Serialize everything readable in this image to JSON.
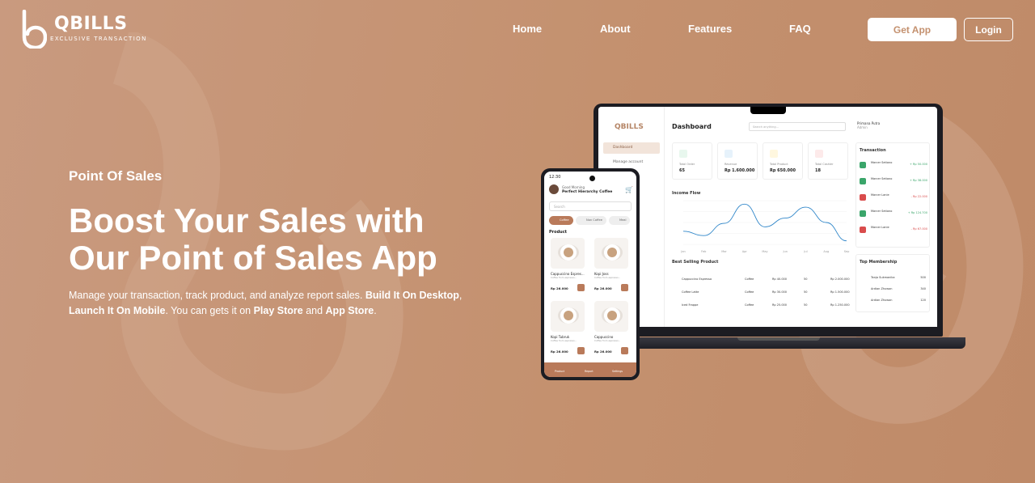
{
  "brand": {
    "name": "QBILLS",
    "tagline": "EXCLUSIVE TRANSACTION"
  },
  "nav": {
    "links": [
      "Home",
      "About",
      "Features",
      "FAQ"
    ],
    "get_app": "Get App",
    "login": "Login"
  },
  "hero": {
    "eyebrow": "Point Of Sales",
    "headline_line1": "Boost Your Sales with",
    "headline_line2": "Our Point of Sales App",
    "desc_1": "Manage your transaction, track product, and analyze report sales. ",
    "desc_b1": "Build It On Desktop",
    "desc_2": ", ",
    "desc_b2": "Launch It On Mobile",
    "desc_3": ". You can gets it on ",
    "desc_b3": "Play Store",
    "desc_4": " and ",
    "desc_b4": "App Store",
    "desc_5": "."
  },
  "dashboard": {
    "logo": "QBILLS",
    "menu": [
      "Dashboard",
      "Manage account"
    ],
    "title": "Dashboard",
    "search_placeholder": "Search anything...",
    "profile_name": "Primana Putra",
    "profile_role": "Admin",
    "cards": [
      {
        "label": "Total Order",
        "value": "65",
        "color": "#e8f7ee",
        "icon_color": "#3aa56a"
      },
      {
        "label": "Revenue",
        "value": "Rp 1.600.000",
        "color": "#e6f2fb",
        "icon_color": "#2f86c9"
      },
      {
        "label": "Total Product",
        "value": "Rp 650.000",
        "color": "#fff7df",
        "icon_color": "#e9b320"
      },
      {
        "label": "Total Cashier",
        "value": "18",
        "color": "#fdeaea",
        "icon_color": "#d94c4c"
      }
    ],
    "income_flow_title": "Income Flow",
    "chart_data": {
      "type": "line",
      "categories": [
        "Jan",
        "Feb",
        "Mar",
        "Apr",
        "May",
        "Jun",
        "Jul",
        "Aug",
        "Sep"
      ],
      "series": [
        {
          "values": [
            30,
            20,
            48,
            92,
            40,
            60,
            85,
            50,
            8
          ]
        }
      ],
      "ylim": [
        0,
        100
      ]
    },
    "best_selling_title": "Best Selling Product",
    "best_selling": [
      {
        "name": "Cappuccino Espresso",
        "category": "Coffee",
        "price": "Rp 40.000",
        "qty": "50",
        "total": "Rp 2.000.000"
      },
      {
        "name": "Coffee Latte",
        "category": "Coffee",
        "price": "Rp 30.000",
        "qty": "50",
        "total": "Rp 1.500.000"
      },
      {
        "name": "Iced Frappe",
        "category": "Coffee",
        "price": "Rp 25.000",
        "qty": "50",
        "total": "Rp 1.250.000"
      }
    ],
    "transaction_title": "Transaction",
    "transactions": [
      {
        "name": "Marcer Setiono",
        "amount": "+ Rp 50.000",
        "in": true
      },
      {
        "name": "Marcer Setiono",
        "amount": "+ Rp 38.000",
        "in": true
      },
      {
        "name": "Marcer Lanie",
        "amount": "- Rp 22.000",
        "in": false
      },
      {
        "name": "Marcer Setiono",
        "amount": "+ Rp 124.700",
        "in": true
      },
      {
        "name": "Marcer Lanie",
        "amount": "- Rp 67.000",
        "in": false
      }
    ],
    "membership_title": "Top Membership",
    "members": [
      {
        "name": "Tanjo Sukmanika",
        "points": "500"
      },
      {
        "name": "Ardian Zhuwon",
        "points": "340"
      },
      {
        "name": "Ardian Zhuwon",
        "points": "120"
      }
    ]
  },
  "mobile": {
    "time": "12:30",
    "greeting": "Good Morning",
    "store": "Perfect Hierarchy Coffee",
    "search_placeholder": "Search",
    "chips": [
      "Coffee",
      "Non Coffee",
      "Meal"
    ],
    "section": "Product",
    "products": [
      {
        "name": "Cappuccino Espres...",
        "desc": "Coffee from espresso...",
        "price": "Rp 26.000"
      },
      {
        "name": "Kopi Joss",
        "desc": "Coffee from espresso...",
        "price": "Rp 26.000"
      },
      {
        "name": "Kopi Tubruk",
        "desc": "Coffee from espresso...",
        "price": "Rp 26.000"
      },
      {
        "name": "Cappuccino",
        "desc": "Coffee from espresso...",
        "price": "Rp 26.000"
      }
    ],
    "tabs": [
      "Product",
      "Report",
      "Settings"
    ]
  },
  "colors": {
    "accent": "#c4916f",
    "accent_dark": "#b97a5a"
  }
}
